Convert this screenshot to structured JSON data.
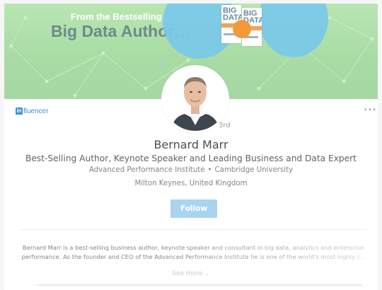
{
  "banner": {
    "line1": "From the Bestselling",
    "line2": "Big Data Author…",
    "book1_title": "BIG DATA",
    "book2_title": "BIG DATA"
  },
  "badge": {
    "brand": "in",
    "label": "fluencer"
  },
  "menu": {
    "more_icon": "more-horizontal-icon"
  },
  "profile": {
    "degree": "3rd",
    "name": "Bernard Marr",
    "headline": "Best-Selling Author, Keynote Speaker and Leading Business and Data Expert",
    "org1": "Advanced Performance Institute",
    "org_separator": "•",
    "org2": "Cambridge University",
    "location": "Milton Keynes, United Kingdom"
  },
  "actions": {
    "follow_label": "Follow"
  },
  "summary": {
    "line1": "Bernard Marr is a best-selling business author, keynote speaker and consultant in big data, analytics and enterprise",
    "line2": "performance. As the founder and CEO of the Advanced Performance Institute he is one of the world's most highly r...",
    "see_more": "See more"
  },
  "colors": {
    "banner_green": "#b9e6b3",
    "influencer_blue": "#3a8fd0",
    "follow_button": "#a8d4ee",
    "quote_circle": "#78c8eb",
    "badge_orange": "#f29a3a"
  }
}
